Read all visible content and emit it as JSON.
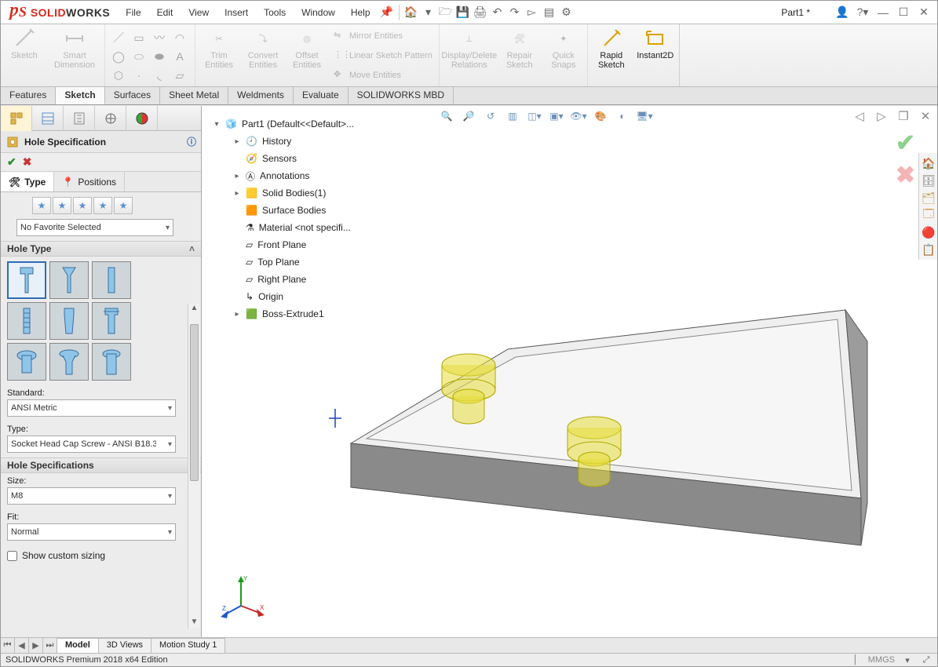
{
  "app": {
    "brand_prefix": "SOLID",
    "brand_suffix": "WORKS",
    "doc": "Part1 *"
  },
  "menu": [
    "File",
    "Edit",
    "View",
    "Insert",
    "Tools",
    "Window",
    "Help"
  ],
  "ribbon": {
    "sketch": "Sketch",
    "smart_dim": "Smart\nDimension",
    "trim": "Trim\nEntities",
    "convert": "Convert\nEntities",
    "offset": "Offset\nEntities",
    "mirror": "Mirror Entities",
    "pattern": "Linear Sketch Pattern",
    "move": "Move Entities",
    "disp_del": "Display/Delete\nRelations",
    "repair": "Repair\nSketch",
    "quick": "Quick\nSnaps",
    "rapid": "Rapid\nSketch",
    "instant": "Instant2D"
  },
  "cmdtabs": [
    "Features",
    "Sketch",
    "Surfaces",
    "Sheet Metal",
    "Weldments",
    "Evaluate",
    "SOLIDWORKS MBD"
  ],
  "cmdtab_active": 1,
  "pm": {
    "title": "Hole Specification",
    "tabs": {
      "type": "Type",
      "positions": "Positions"
    },
    "fav_none": "No Favorite Selected",
    "hole_type_hd": "Hole Type",
    "standard_lbl": "Standard:",
    "standard_val": "ANSI Metric",
    "type_lbl": "Type:",
    "type_val": "Socket Head Cap Screw - ANSI B18.3",
    "spec_hd": "Hole Specifications",
    "size_lbl": "Size:",
    "size_val": "M8",
    "fit_lbl": "Fit:",
    "fit_val": "Normal",
    "custom": "Show custom sizing"
  },
  "tree": {
    "root": "Part1  (Default<<Default>...",
    "history": "History",
    "sensors": "Sensors",
    "annotations": "Annotations",
    "solid": "Solid Bodies(1)",
    "surface": "Surface Bodies",
    "material": "Material <not specifi...",
    "front": "Front Plane",
    "top": "Top Plane",
    "right": "Right Plane",
    "origin": "Origin",
    "extrude": "Boss-Extrude1"
  },
  "bottom": {
    "model": "Model",
    "views": "3D Views",
    "motion": "Motion Study 1"
  },
  "status": {
    "text": "SOLIDWORKS Premium 2018 x64 Edition",
    "units": "MMGS"
  }
}
